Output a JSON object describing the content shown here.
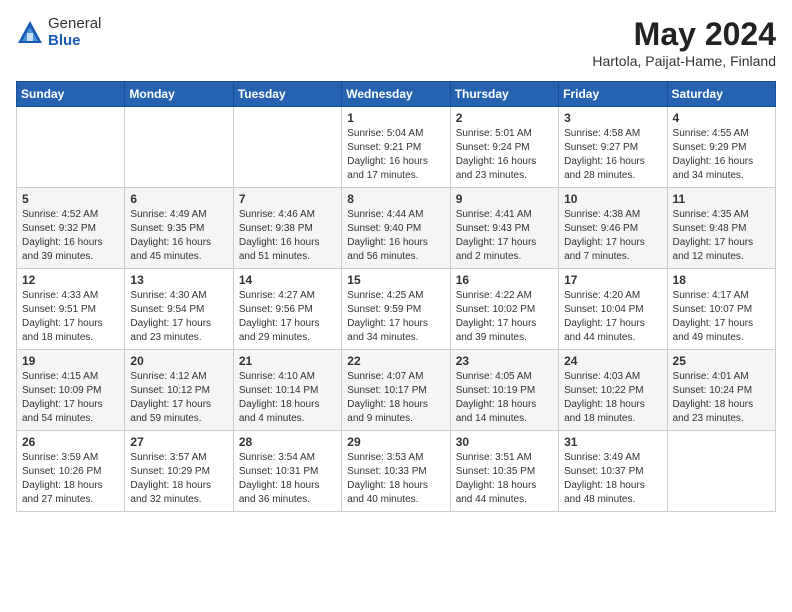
{
  "logo": {
    "general": "General",
    "blue": "Blue"
  },
  "title": {
    "month": "May 2024",
    "location": "Hartola, Paijat-Hame, Finland"
  },
  "headers": [
    "Sunday",
    "Monday",
    "Tuesday",
    "Wednesday",
    "Thursday",
    "Friday",
    "Saturday"
  ],
  "weeks": [
    [
      {
        "day": "",
        "sunrise": "",
        "sunset": "",
        "daylight": ""
      },
      {
        "day": "",
        "sunrise": "",
        "sunset": "",
        "daylight": ""
      },
      {
        "day": "",
        "sunrise": "",
        "sunset": "",
        "daylight": ""
      },
      {
        "day": "1",
        "sunrise": "Sunrise: 5:04 AM",
        "sunset": "Sunset: 9:21 PM",
        "daylight": "Daylight: 16 hours and 17 minutes."
      },
      {
        "day": "2",
        "sunrise": "Sunrise: 5:01 AM",
        "sunset": "Sunset: 9:24 PM",
        "daylight": "Daylight: 16 hours and 23 minutes."
      },
      {
        "day": "3",
        "sunrise": "Sunrise: 4:58 AM",
        "sunset": "Sunset: 9:27 PM",
        "daylight": "Daylight: 16 hours and 28 minutes."
      },
      {
        "day": "4",
        "sunrise": "Sunrise: 4:55 AM",
        "sunset": "Sunset: 9:29 PM",
        "daylight": "Daylight: 16 hours and 34 minutes."
      }
    ],
    [
      {
        "day": "5",
        "sunrise": "Sunrise: 4:52 AM",
        "sunset": "Sunset: 9:32 PM",
        "daylight": "Daylight: 16 hours and 39 minutes."
      },
      {
        "day": "6",
        "sunrise": "Sunrise: 4:49 AM",
        "sunset": "Sunset: 9:35 PM",
        "daylight": "Daylight: 16 hours and 45 minutes."
      },
      {
        "day": "7",
        "sunrise": "Sunrise: 4:46 AM",
        "sunset": "Sunset: 9:38 PM",
        "daylight": "Daylight: 16 hours and 51 minutes."
      },
      {
        "day": "8",
        "sunrise": "Sunrise: 4:44 AM",
        "sunset": "Sunset: 9:40 PM",
        "daylight": "Daylight: 16 hours and 56 minutes."
      },
      {
        "day": "9",
        "sunrise": "Sunrise: 4:41 AM",
        "sunset": "Sunset: 9:43 PM",
        "daylight": "Daylight: 17 hours and 2 minutes."
      },
      {
        "day": "10",
        "sunrise": "Sunrise: 4:38 AM",
        "sunset": "Sunset: 9:46 PM",
        "daylight": "Daylight: 17 hours and 7 minutes."
      },
      {
        "day": "11",
        "sunrise": "Sunrise: 4:35 AM",
        "sunset": "Sunset: 9:48 PM",
        "daylight": "Daylight: 17 hours and 12 minutes."
      }
    ],
    [
      {
        "day": "12",
        "sunrise": "Sunrise: 4:33 AM",
        "sunset": "Sunset: 9:51 PM",
        "daylight": "Daylight: 17 hours and 18 minutes."
      },
      {
        "day": "13",
        "sunrise": "Sunrise: 4:30 AM",
        "sunset": "Sunset: 9:54 PM",
        "daylight": "Daylight: 17 hours and 23 minutes."
      },
      {
        "day": "14",
        "sunrise": "Sunrise: 4:27 AM",
        "sunset": "Sunset: 9:56 PM",
        "daylight": "Daylight: 17 hours and 29 minutes."
      },
      {
        "day": "15",
        "sunrise": "Sunrise: 4:25 AM",
        "sunset": "Sunset: 9:59 PM",
        "daylight": "Daylight: 17 hours and 34 minutes."
      },
      {
        "day": "16",
        "sunrise": "Sunrise: 4:22 AM",
        "sunset": "Sunset: 10:02 PM",
        "daylight": "Daylight: 17 hours and 39 minutes."
      },
      {
        "day": "17",
        "sunrise": "Sunrise: 4:20 AM",
        "sunset": "Sunset: 10:04 PM",
        "daylight": "Daylight: 17 hours and 44 minutes."
      },
      {
        "day": "18",
        "sunrise": "Sunrise: 4:17 AM",
        "sunset": "Sunset: 10:07 PM",
        "daylight": "Daylight: 17 hours and 49 minutes."
      }
    ],
    [
      {
        "day": "19",
        "sunrise": "Sunrise: 4:15 AM",
        "sunset": "Sunset: 10:09 PM",
        "daylight": "Daylight: 17 hours and 54 minutes."
      },
      {
        "day": "20",
        "sunrise": "Sunrise: 4:12 AM",
        "sunset": "Sunset: 10:12 PM",
        "daylight": "Daylight: 17 hours and 59 minutes."
      },
      {
        "day": "21",
        "sunrise": "Sunrise: 4:10 AM",
        "sunset": "Sunset: 10:14 PM",
        "daylight": "Daylight: 18 hours and 4 minutes."
      },
      {
        "day": "22",
        "sunrise": "Sunrise: 4:07 AM",
        "sunset": "Sunset: 10:17 PM",
        "daylight": "Daylight: 18 hours and 9 minutes."
      },
      {
        "day": "23",
        "sunrise": "Sunrise: 4:05 AM",
        "sunset": "Sunset: 10:19 PM",
        "daylight": "Daylight: 18 hours and 14 minutes."
      },
      {
        "day": "24",
        "sunrise": "Sunrise: 4:03 AM",
        "sunset": "Sunset: 10:22 PM",
        "daylight": "Daylight: 18 hours and 18 minutes."
      },
      {
        "day": "25",
        "sunrise": "Sunrise: 4:01 AM",
        "sunset": "Sunset: 10:24 PM",
        "daylight": "Daylight: 18 hours and 23 minutes."
      }
    ],
    [
      {
        "day": "26",
        "sunrise": "Sunrise: 3:59 AM",
        "sunset": "Sunset: 10:26 PM",
        "daylight": "Daylight: 18 hours and 27 minutes."
      },
      {
        "day": "27",
        "sunrise": "Sunrise: 3:57 AM",
        "sunset": "Sunset: 10:29 PM",
        "daylight": "Daylight: 18 hours and 32 minutes."
      },
      {
        "day": "28",
        "sunrise": "Sunrise: 3:54 AM",
        "sunset": "Sunset: 10:31 PM",
        "daylight": "Daylight: 18 hours and 36 minutes."
      },
      {
        "day": "29",
        "sunrise": "Sunrise: 3:53 AM",
        "sunset": "Sunset: 10:33 PM",
        "daylight": "Daylight: 18 hours and 40 minutes."
      },
      {
        "day": "30",
        "sunrise": "Sunrise: 3:51 AM",
        "sunset": "Sunset: 10:35 PM",
        "daylight": "Daylight: 18 hours and 44 minutes."
      },
      {
        "day": "31",
        "sunrise": "Sunrise: 3:49 AM",
        "sunset": "Sunset: 10:37 PM",
        "daylight": "Daylight: 18 hours and 48 minutes."
      },
      {
        "day": "",
        "sunrise": "",
        "sunset": "",
        "daylight": ""
      }
    ]
  ]
}
